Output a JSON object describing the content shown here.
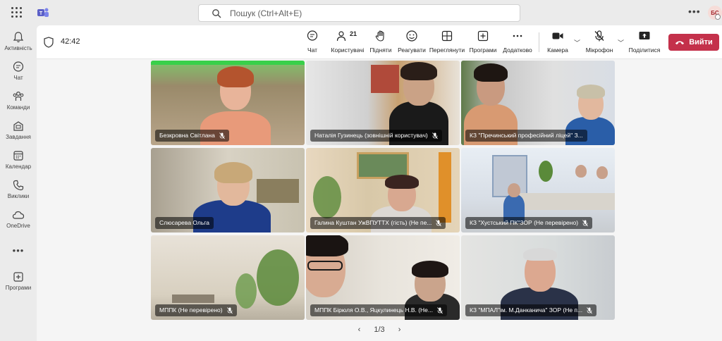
{
  "top": {
    "search_placeholder": "Пошук (Ctrl+Alt+E)",
    "avatar_initials": "БС"
  },
  "rail": {
    "items": [
      {
        "label": "Активність",
        "icon": "bell-icon"
      },
      {
        "label": "Чат",
        "icon": "chat-icon"
      },
      {
        "label": "Команди",
        "icon": "teams-icon"
      },
      {
        "label": "Завдання",
        "icon": "assignments-icon"
      },
      {
        "label": "Календар",
        "icon": "calendar-icon"
      },
      {
        "label": "Виклики",
        "icon": "phone-icon"
      },
      {
        "label": "OneDrive",
        "icon": "cloud-icon"
      },
      {
        "label": "Програми",
        "icon": "apps-plus-icon"
      }
    ]
  },
  "toolbar": {
    "timer": "42:42",
    "chat": "Чат",
    "participants": "Користувачі",
    "participants_count": "21",
    "raise": "Підняти",
    "react": "Реагувати",
    "view": "Переглянути",
    "apps": "Програми",
    "more": "Додатково",
    "camera": "Камера",
    "mic": "Мікрофон",
    "share": "Поділитися",
    "leave": "Вийти"
  },
  "tiles": [
    {
      "name": "Безкровна Світлана"
    },
    {
      "name": "Наталія Гузинець (зовнішній користувач)"
    },
    {
      "name": "КЗ \"Пречинський професійний лiцей\" З..."
    },
    {
      "name": "Слюсарева Ольга"
    },
    {
      "name": "Галина Куштан УжВПУТТХ (гість) (Не пе..."
    },
    {
      "name": "КЗ \"Хустський ПК\"ЗОР (Не перевірено)"
    },
    {
      "name": "МППК (Не перевірено)"
    },
    {
      "name": "МППК Бірюля О.В., Яцкулинець Н.В. (Не..."
    },
    {
      "name": "КЗ \"МПАЛ\"ім. М.Данканича\" ЗОР (Не п..."
    }
  ],
  "pager": {
    "label": "1/3"
  },
  "colors": {
    "leave": "#c4314b",
    "teams": "#5b5fc7"
  }
}
